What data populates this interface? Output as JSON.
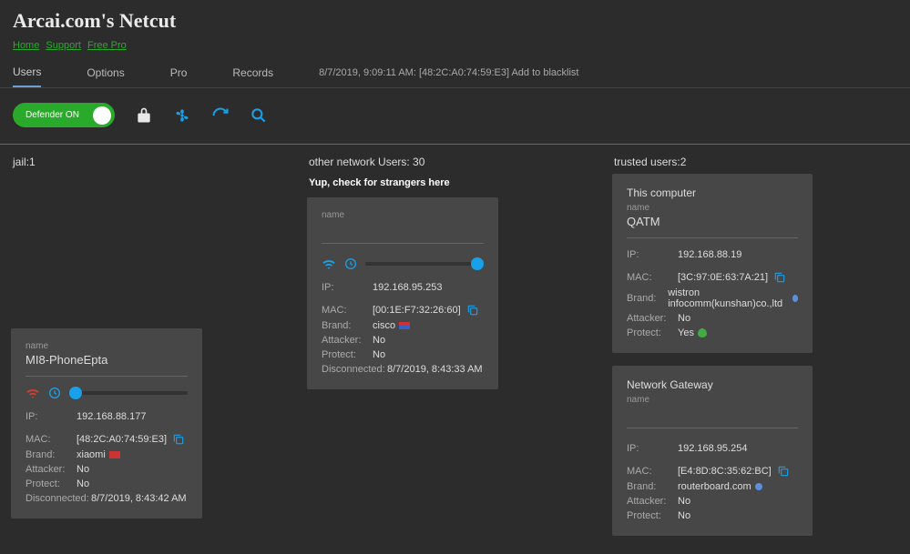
{
  "header": {
    "title": "Arcai.com's Netcut"
  },
  "topLinks": [
    "Home",
    "Support",
    "Free Pro"
  ],
  "tabs": {
    "items": [
      "Users",
      "Options",
      "Pro",
      "Records"
    ],
    "activeIndex": 0
  },
  "statusLine": "8/7/2019, 9:09:11 AM: [48:2C:A0:74:59:E3] Add to blacklist",
  "toolbar": {
    "defender": "Defender ON",
    "icons": [
      "lock-icon",
      "fan-icon",
      "refresh-icon",
      "search-icon"
    ]
  },
  "columns": {
    "jail": {
      "header": "jail:1",
      "card": {
        "nameLabel": "name",
        "name": "MI8-PhoneEpta",
        "ip": "192.168.88.177",
        "mac": "[48:2C:A0:74:59:E3]",
        "brand": "xiaomi",
        "attacker": "No",
        "protect": "No",
        "disconnected": "8/7/2019, 8:43:42 AM"
      }
    },
    "other": {
      "header": "other network Users: 30",
      "hint": "Yup, check for strangers here",
      "card": {
        "nameLabel": "name",
        "ip": "192.168.95.253",
        "mac": "[00:1E:F7:32:26:60]",
        "brand": "cisco",
        "attacker": "No",
        "protect": "No",
        "disconnected": "8/7/2019, 8:43:33 AM"
      }
    },
    "trusted": {
      "header": "trusted users:2",
      "card1": {
        "title": "This computer",
        "nameLabel": "name",
        "name": "QATM",
        "ip": "192.168.88.19",
        "mac": "[3C:97:0E:63:7A:21]",
        "brandLabel": "Brand:",
        "brand": "wistron infocomm(kunshan)co.,ltd",
        "attacker": "No",
        "protect": "Yes"
      },
      "card2": {
        "title": "Network Gateway",
        "nameLabel": "name",
        "ip": "192.168.95.254",
        "mac": "[E4:8D:8C:35:62:BC]",
        "brand": "routerboard.com",
        "attacker": "No",
        "protect": "No"
      }
    }
  },
  "labels": {
    "ip": "IP:",
    "mac": "MAC:",
    "brand": "Brand:",
    "attacker": "Attacker:",
    "protect": "Protect:",
    "disconnected": "Disconnected:"
  }
}
